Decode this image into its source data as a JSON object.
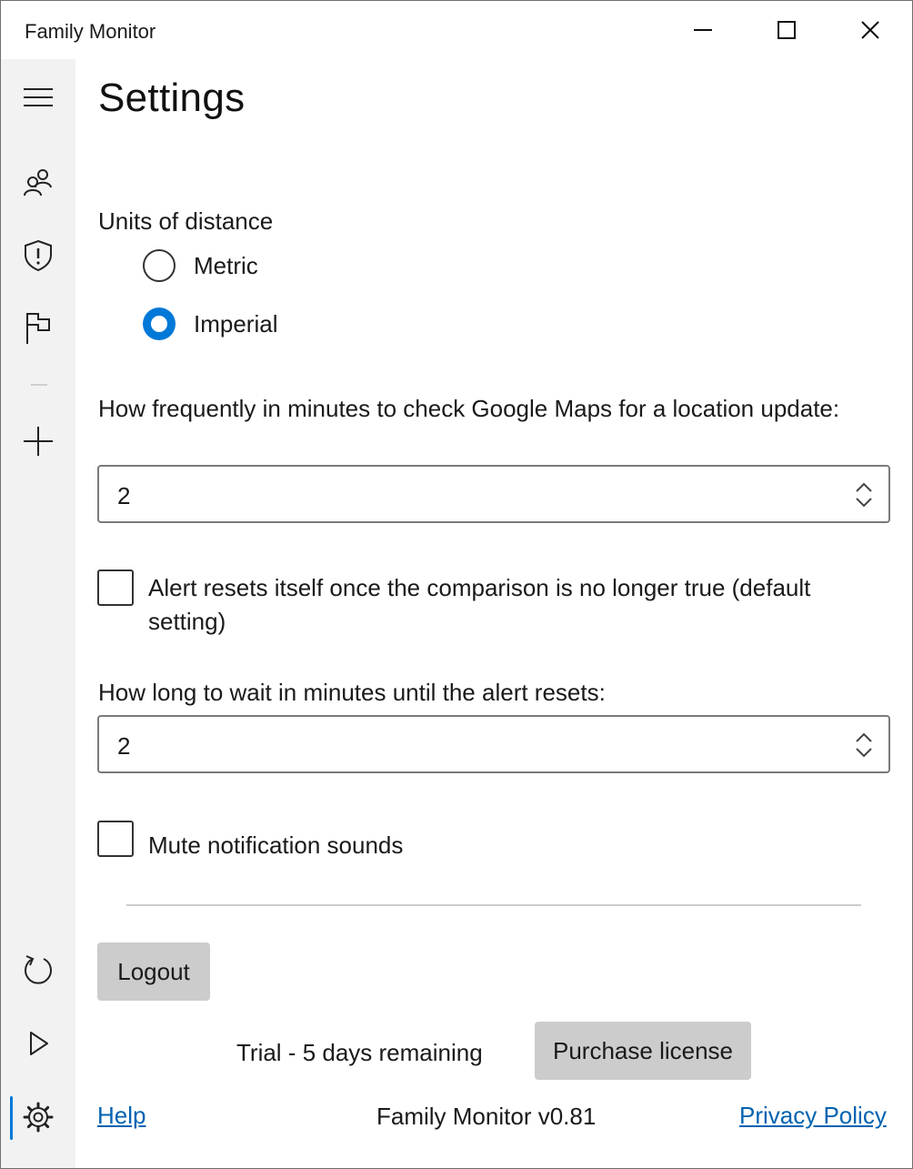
{
  "window": {
    "title": "Family Monitor"
  },
  "nav": {
    "top_items": [
      "hamburger-menu-icon",
      "people-icon",
      "shield-alert-icon",
      "flag-icon",
      "add-icon"
    ],
    "bottom_items": [
      "refresh-icon",
      "play-icon",
      "settings-icon"
    ],
    "active": "settings-icon"
  },
  "page": {
    "title": "Settings"
  },
  "units": {
    "label": "Units of distance",
    "options": [
      {
        "label": "Metric",
        "selected": false
      },
      {
        "label": "Imperial",
        "selected": true
      }
    ]
  },
  "frequency": {
    "label": "How frequently in minutes to check Google Maps for a location update:",
    "value": "2"
  },
  "alert_reset": {
    "label": "Alert resets itself once the comparison is no longer true (default setting)",
    "checked": false
  },
  "wait": {
    "label": "How long to wait in minutes until the alert resets:",
    "value": "2"
  },
  "mute": {
    "label": "Mute notification sounds",
    "checked": false
  },
  "logout": {
    "label": "Logout"
  },
  "trial": {
    "text": "Trial - 5 days remaining"
  },
  "purchase": {
    "label": "Purchase license"
  },
  "footer": {
    "help": "Help",
    "version": "Family Monitor v0.81",
    "privacy": "Privacy Policy"
  },
  "colors": {
    "accent": "#0078d7",
    "link": "#0063b1",
    "button": "#cccccc",
    "rail": "#f2f2f2"
  }
}
